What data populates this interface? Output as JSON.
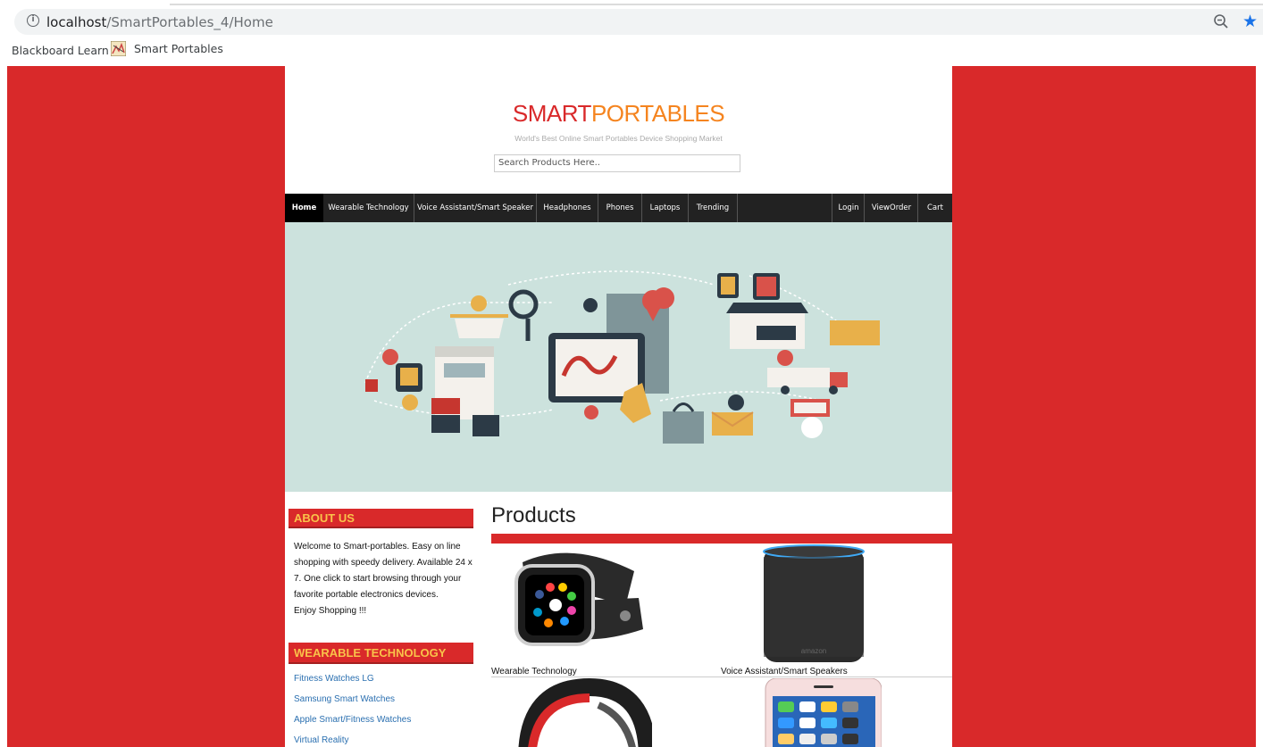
{
  "browser": {
    "url_host": "localhost",
    "url_path": "/SmartPortables_4/Home",
    "bookmarks": [
      "Blackboard Learn",
      "Smart Portables"
    ]
  },
  "site": {
    "logo_part1": "SMART",
    "logo_part2": "PORTABLES",
    "tagline": "World's Best Online Smart Portables Device Shopping Market",
    "search_placeholder": "Search Products Here..",
    "colors": {
      "brand_red": "#d9292a",
      "brand_orange": "#f5841f",
      "nav_bg": "#222222",
      "hero_bg": "#cce2dd",
      "heading_yellow": "#f9c34a"
    }
  },
  "nav": {
    "left": [
      "Home",
      "Wearable Technology",
      "Voice Assistant/Smart Speaker",
      "Headphones",
      "Phones",
      "Laptops",
      "Trending"
    ],
    "right": [
      "Login",
      "ViewOrder",
      "Cart"
    ],
    "active": "Home"
  },
  "sidebar": {
    "about_title": "ABOUT US",
    "about_lines": [
      "Welcome to Smart-portables. Easy on line",
      "shopping with speedy delivery. Available 24 x",
      "7. One click to start browsing through your",
      "favorite portable electronics devices.",
      "Enjoy Shopping !!!"
    ],
    "wearable_title": "WEARABLE TECHNOLOGY",
    "wearable_links": [
      "Fitness Watches LG",
      "Samsung Smart Watches",
      "Apple Smart/Fitness Watches",
      "Virtual Reality"
    ]
  },
  "products": {
    "title": "Products",
    "items": [
      {
        "caption": "Wearable Technology",
        "icon": "smartwatch-image"
      },
      {
        "caption": "Voice Assistant/Smart Speakers",
        "icon": "smart-speaker-image"
      },
      {
        "caption": "",
        "icon": "headphones-image"
      },
      {
        "caption": "",
        "icon": "smartphone-image"
      }
    ]
  }
}
